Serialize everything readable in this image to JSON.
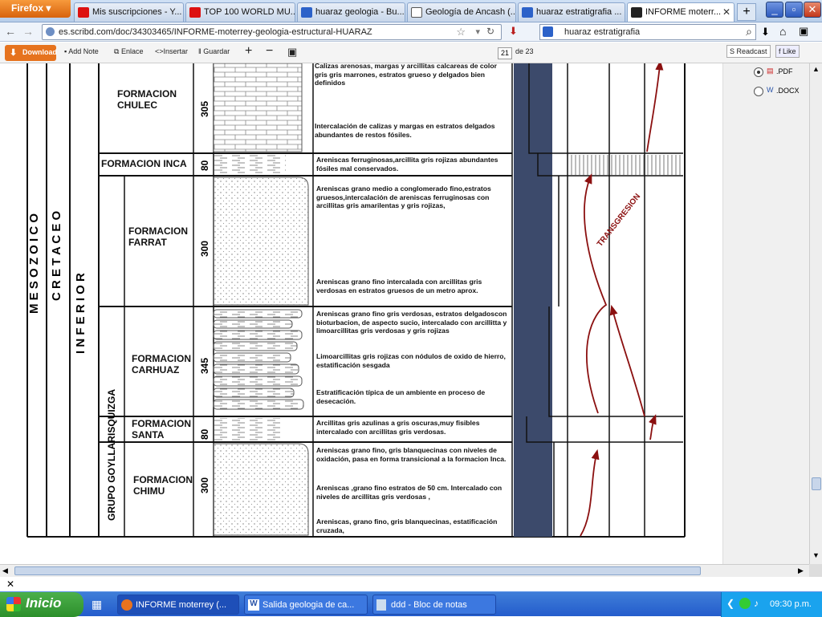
{
  "browser": {
    "menu_button": "Firefox",
    "tabs": [
      {
        "label": "Mis suscripciones - Y...",
        "icon": "youtube-icon"
      },
      {
        "label": "TOP 100 WORLD MU...",
        "icon": "youtube-icon"
      },
      {
        "label": "huaraz geologia - Bu...",
        "icon": "google-icon"
      },
      {
        "label": "Geología de Ancash (...",
        "icon": "page-icon"
      },
      {
        "label": "huaraz estratigrafia ...",
        "icon": "google-icon"
      },
      {
        "label": "INFORME moterr...",
        "icon": "scribd-icon"
      }
    ],
    "new_tab": "+",
    "window_buttons": [
      "_",
      "▫",
      "✕"
    ],
    "url": "es.scribd.com/doc/34303465/INFORME-moterrey-geologia-estructural-HUARAZ",
    "search_value": "huaraz estratigrafia"
  },
  "scribd_toolbar": {
    "download": "Download",
    "add_note": "Add Note",
    "enlace": "Enlace",
    "insertar": "Insertar",
    "guardar": "Guardar",
    "page_current": "21",
    "page_total": "de 23",
    "readcast": "Readcast",
    "like": "Like"
  },
  "side_panel": {
    "options": [
      {
        "label": ".PDF",
        "selected": true
      },
      {
        "label": ".DOCX",
        "selected": false
      }
    ]
  },
  "column": {
    "era": "M E S O Z O I C O",
    "period": "C R E T A C E O",
    "epoch": "I N F E R I O R",
    "group": "GRUPO GOYLLARISQUIZGA",
    "transgression": "TRANSGRESION"
  },
  "formations": [
    {
      "name": "FORMACION CHULEC",
      "thickness": "305",
      "desc_top": "Calizas arenosas, margas y arcillitas calcareas de color gris gris marrones, estratos grueso y delgados bien definidos",
      "desc_bottom": "Intercalación de calizas y margas en estratos delgados abundantes de restos fósiles."
    },
    {
      "name": "FORMACION INCA",
      "thickness": "80",
      "desc_top": "Areniscas ferruginosas,arcillita gris rojizas abundantes fósiles mal conservados.",
      "desc_bottom": ""
    },
    {
      "name": "FORMACION FARRAT",
      "thickness": "300",
      "desc_top": "Areniscas grano medio a conglomerado fino,estratos gruesos,intercalación de areniscas ferruginosas con arcillitas gris amarilentas y gris rojizas,",
      "desc_bottom": "Areniscas grano fino intercalada con arcillitas gris verdosas en estratos gruesos de un metro aprox."
    },
    {
      "name": "FORMACION CARHUAZ",
      "thickness": "345",
      "desc_top": "Areniscas grano fino gris verdosas, estratos delgadoscon bioturbacion, de aspecto sucio, intercalado con arcillitta y limoarcillitas gris verdosas y gris rojizas",
      "desc_mid": "Limoarcillitas gris rojizas con nódulos de oxido de hierro, estatificación sesgada",
      "desc_bottom": "Estratificación típica de un ambiente en proceso de desecación."
    },
    {
      "name": "FORMACION SANTA",
      "thickness": "80",
      "desc_top": "Arcillitas gris azulinas a gris oscuras,muy fisibles intercalado con arcillitas gris verdosas.",
      "desc_bottom": ""
    },
    {
      "name": "FORMACION CHIMU",
      "thickness": "300",
      "desc_top": "Areniscas grano fino, gris blanquecinas con niveles de oxidación, pasa en forma transicional a la formacion Inca.",
      "desc_mid": "Areniscas ,grano fino estratos de 50 cm. Intercalado con niveles de arcillitas gris verdosas ,",
      "desc_bottom": "Areniscas, grano fino, gris blanquecinas, estatificación cruzada,"
    }
  ],
  "taskbar": {
    "start": "Inicio",
    "tasks": [
      "INFORME moterrey (...",
      "Salida geologia de ca...",
      "ddd - Bloc de notas"
    ],
    "clock": "09:30 p.m."
  }
}
